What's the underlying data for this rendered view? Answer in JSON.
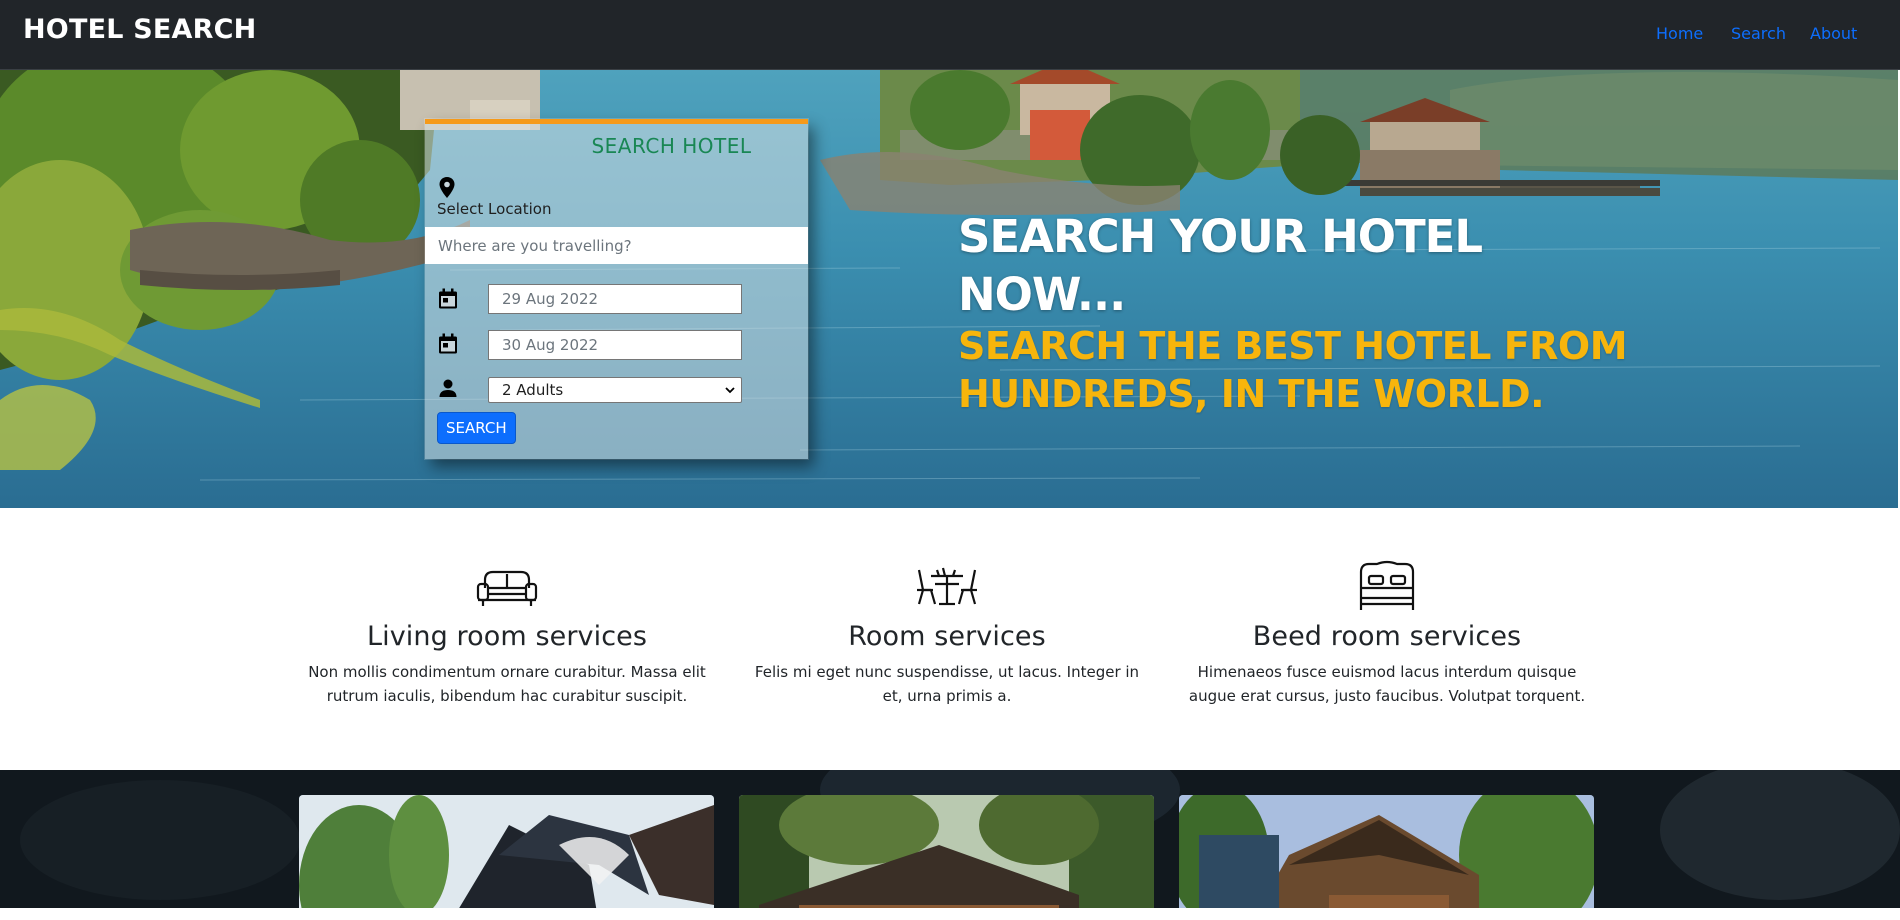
{
  "navbar": {
    "brand": "HOTEL SEARCH",
    "links": {
      "home": "Home",
      "search": "Search",
      "about": "About"
    }
  },
  "hero": {
    "title": "SEARCH YOUR HOTEL NOW...",
    "subtitle_line1": "SEARCH THE BEST HOTEL FROM",
    "subtitle_line2": "HUNDREDS, IN THE WORLD."
  },
  "search_card": {
    "title": "SEARCH HOTEL",
    "location_label": "Select Location",
    "location_placeholder": "Where are you travelling?",
    "check_in": "29 Aug 2022",
    "check_out": "30 Aug 2022",
    "guests": "2 Adults",
    "button_label": "SEARCH"
  },
  "services": [
    {
      "icon": "sofa-icon",
      "title": "Living room services",
      "description": "Non mollis condimentum ornare curabitur. Massa elit rutrum iaculis, bibendum hac curabitur suscipit."
    },
    {
      "icon": "dining-table-icon",
      "title": "Room services",
      "description": "Felis mi eget nunc suspendisse, ut lacus. Integer in et, urna primis a."
    },
    {
      "icon": "bed-icon",
      "title": "Beed room services",
      "description": "Himenaeos fusce euismod lacus interdum quisque augue erat cursus, justo faucibus. Volutpat torquent."
    }
  ],
  "colors": {
    "navbar_bg": "#212529",
    "link": "#0d6efd",
    "accent_orange": "#f59a1a",
    "subtitle_yellow": "#f7b50c",
    "card_title_green": "#198754",
    "button_blue": "#0d6efd"
  }
}
